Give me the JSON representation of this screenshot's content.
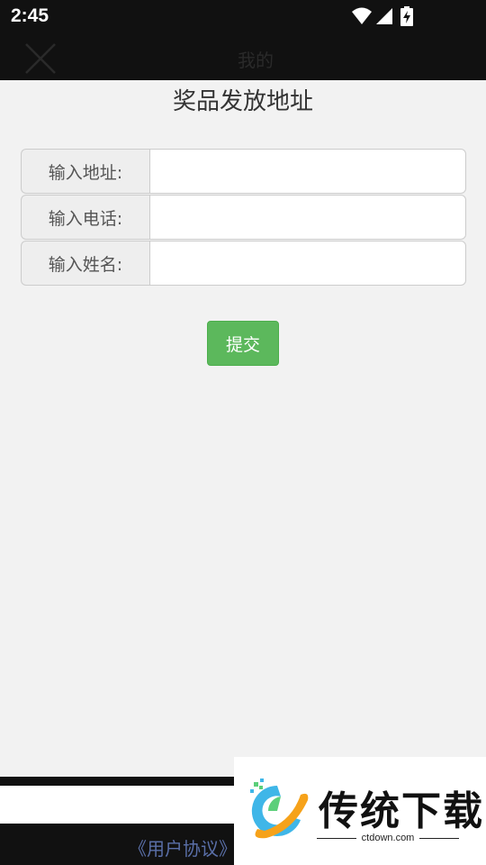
{
  "status_bar": {
    "time": "2:45",
    "icons": [
      "wifi-icon",
      "cell-signal-icon",
      "battery-charging-icon"
    ]
  },
  "app_bar": {
    "title": "我的",
    "close_icon": "close-icon"
  },
  "page": {
    "title": "奖品发放地址"
  },
  "form": {
    "fields": [
      {
        "label": "输入地址:",
        "value": "",
        "placeholder": ""
      },
      {
        "label": "输入电话:",
        "value": "",
        "placeholder": ""
      },
      {
        "label": "输入姓名:",
        "value": "",
        "placeholder": ""
      }
    ],
    "submit_label": "提交"
  },
  "footer": {
    "agreement_link": "《用户协议》"
  },
  "watermark": {
    "brand": "传统下载",
    "domain": "ctdown.com"
  },
  "colors": {
    "bar_bg": "#111111",
    "page_bg": "#f2f2f2",
    "submit_green": "#5cb85c",
    "link_blue": "#5a6fa8"
  }
}
